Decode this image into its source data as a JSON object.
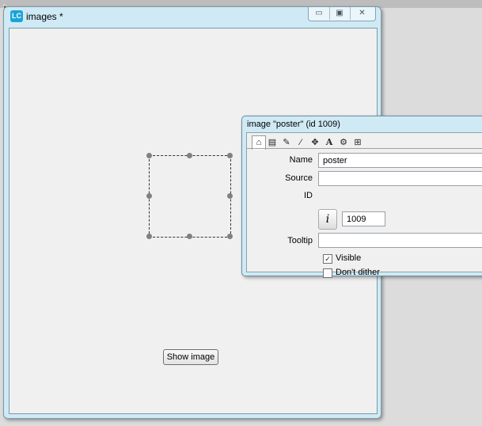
{
  "main_window": {
    "title": "images *",
    "app_icon_text": "LC",
    "caption_buttons": {
      "minimize": "▭",
      "maximize": "▣",
      "close": "✕"
    },
    "show_button_label": "Show image"
  },
  "inspector": {
    "title": "image \"poster\" (id 1009)",
    "tabs": [
      {
        "icon": "home-icon",
        "glyph": "⌂"
      },
      {
        "icon": "database-icon",
        "glyph": "▤"
      },
      {
        "icon": "pencil-icon",
        "glyph": "✎"
      },
      {
        "icon": "wand-icon",
        "glyph": "⁄"
      },
      {
        "icon": "move-icon",
        "glyph": "✥"
      },
      {
        "icon": "text-icon",
        "glyph": "A"
      },
      {
        "icon": "gears-icon",
        "glyph": "⚙"
      },
      {
        "icon": "layout-icon",
        "glyph": "⊞"
      }
    ],
    "name_label": "Name",
    "name_value": "poster",
    "source_label": "Source",
    "source_value": "",
    "id_label": "ID",
    "id_glyph": "i",
    "id_value": "1009",
    "tooltip_label": "Tooltip",
    "tooltip_value": "",
    "visible_label": "Visible",
    "visible_checked": true,
    "visible_mark": "✓",
    "dither_label": "Don't dither",
    "dither_checked": false
  }
}
